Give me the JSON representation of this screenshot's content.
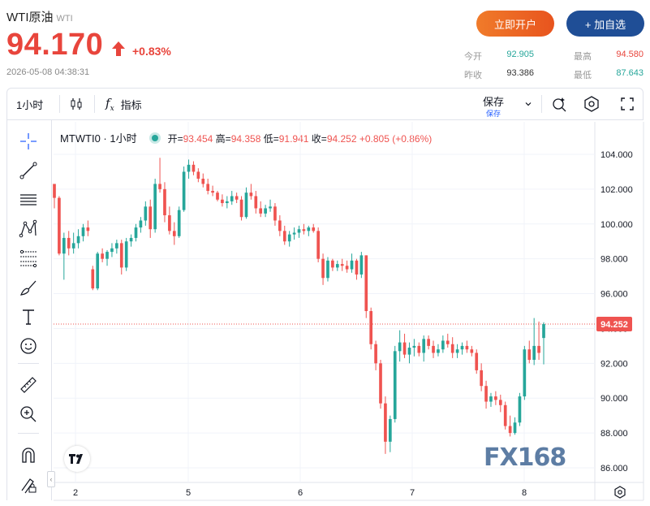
{
  "header": {
    "title": "WTI原油",
    "code": "WTI",
    "price": "94.170",
    "change_pct": "+0.83%",
    "timestamp": "2026-05-08 04:38:31",
    "open_button": "立即开户",
    "watch_button": "+ 加自选",
    "stats": {
      "open_label": "今开",
      "open_value": "92.905",
      "high_label": "最高",
      "high_value": "94.580",
      "prev_label": "昨收",
      "prev_value": "93.386",
      "low_label": "最低",
      "low_value": "87.643"
    },
    "up_color": "#e8453c"
  },
  "toolbar": {
    "interval": "1小时",
    "indicators": "指标",
    "save": "保存",
    "save_sub": "保存"
  },
  "legend": {
    "symbol": "MTWTI0 · 1小时",
    "open_label": "开=",
    "open_value": "93.454",
    "high_label": "高=",
    "high_value": "94.358",
    "low_label": "低=",
    "low_value": "91.941",
    "close_label": "收=",
    "close_value": "94.252",
    "change": "+0.805 (+0.86%)"
  },
  "watermark": "FX168",
  "chart_data": {
    "type": "candlestick",
    "title": "MTWTI0 · 1小时",
    "x_tick_labels": [
      "2",
      "5",
      "6",
      "7",
      "8"
    ],
    "ylim": [
      85,
      106
    ],
    "y_tick_labels": [
      "104.000",
      "102.000",
      "100.000",
      "98.000",
      "96.000",
      "94.000",
      "92.000",
      "90.000",
      "88.000",
      "86.000"
    ],
    "y_ticks": [
      104,
      102,
      100,
      98,
      96,
      94,
      92,
      90,
      88,
      86
    ],
    "last_price": 94.252,
    "last_price_label": "94.252",
    "up_color": "#26a69a",
    "down_color": "#ef5350",
    "candles": [
      [
        102.3,
        102.3,
        100.9,
        101.5
      ],
      [
        101.5,
        101.6,
        98.2,
        98.3
      ],
      [
        98.3,
        99.5,
        96.8,
        99.2
      ],
      [
        99.2,
        99.6,
        98.2,
        98.6
      ],
      [
        98.6,
        99.5,
        98.3,
        98.9
      ],
      [
        98.9,
        99.7,
        98.6,
        99.3
      ],
      [
        99.3,
        100.0,
        99.0,
        99.8
      ],
      [
        99.8,
        100.2,
        99.3,
        99.6
      ],
      [
        97.4,
        97.6,
        96.2,
        96.3
      ],
      [
        96.3,
        98.4,
        96.2,
        98.3
      ],
      [
        98.3,
        98.6,
        97.8,
        98.0
      ],
      [
        98.0,
        98.5,
        97.6,
        98.4
      ],
      [
        98.4,
        98.9,
        98.1,
        98.6
      ],
      [
        98.6,
        99.1,
        98.3,
        98.9
      ],
      [
        98.9,
        99.1,
        97.1,
        97.5
      ],
      [
        97.5,
        99.2,
        97.3,
        99.0
      ],
      [
        99.0,
        99.4,
        98.7,
        99.2
      ],
      [
        99.2,
        100.0,
        99.0,
        99.8
      ],
      [
        99.8,
        100.4,
        99.5,
        100.2
      ],
      [
        100.2,
        101.3,
        99.9,
        101.0
      ],
      [
        101.0,
        101.4,
        99.2,
        99.7
      ],
      [
        99.7,
        102.6,
        99.5,
        102.3
      ],
      [
        102.3,
        103.8,
        101.8,
        102.0
      ],
      [
        102.0,
        102.4,
        100.1,
        100.5
      ],
      [
        100.5,
        101.0,
        99.4,
        99.6
      ],
      [
        99.6,
        100.1,
        98.8,
        99.3
      ],
      [
        99.3,
        101.0,
        99.2,
        100.8
      ],
      [
        100.8,
        103.3,
        100.7,
        103.0
      ],
      [
        103.0,
        103.7,
        102.6,
        103.4
      ],
      [
        103.4,
        103.6,
        102.8,
        103.0
      ],
      [
        103.0,
        103.2,
        102.4,
        102.6
      ],
      [
        102.6,
        102.9,
        102.1,
        102.3
      ],
      [
        102.3,
        102.6,
        101.7,
        101.9
      ],
      [
        101.9,
        102.2,
        101.6,
        101.8
      ],
      [
        101.8,
        101.9,
        101.3,
        101.4
      ],
      [
        101.4,
        101.7,
        101.0,
        101.2
      ],
      [
        101.2,
        101.6,
        100.9,
        101.3
      ],
      [
        101.3,
        101.9,
        101.1,
        101.6
      ],
      [
        101.6,
        101.8,
        101.2,
        101.4
      ],
      [
        101.4,
        101.6,
        100.2,
        100.4
      ],
      [
        100.4,
        102.1,
        100.3,
        101.8
      ],
      [
        101.8,
        102.3,
        101.4,
        101.6
      ],
      [
        101.6,
        101.9,
        100.6,
        100.9
      ],
      [
        100.9,
        101.3,
        100.4,
        100.6
      ],
      [
        100.6,
        101.1,
        100.4,
        100.9
      ],
      [
        100.9,
        101.4,
        100.7,
        101.0
      ],
      [
        101.0,
        101.2,
        99.9,
        100.2
      ],
      [
        100.2,
        100.5,
        99.3,
        99.6
      ],
      [
        99.6,
        99.9,
        98.8,
        99.0
      ],
      [
        99.0,
        99.6,
        98.7,
        99.4
      ],
      [
        99.4,
        99.8,
        99.1,
        99.5
      ],
      [
        99.5,
        99.9,
        99.2,
        99.7
      ],
      [
        99.7,
        100.0,
        99.4,
        99.6
      ],
      [
        99.6,
        99.9,
        99.3,
        99.8
      ],
      [
        99.8,
        100.0,
        99.5,
        99.6
      ],
      [
        99.6,
        99.8,
        97.8,
        98.0
      ],
      [
        98.0,
        98.3,
        96.5,
        96.9
      ],
      [
        96.9,
        98.1,
        96.7,
        97.9
      ],
      [
        97.9,
        98.0,
        97.3,
        97.5
      ],
      [
        97.5,
        97.9,
        97.3,
        97.7
      ],
      [
        97.7,
        98.0,
        97.3,
        97.6
      ],
      [
        97.6,
        97.9,
        97.2,
        97.4
      ],
      [
        97.4,
        98.3,
        97.2,
        97.9
      ],
      [
        97.9,
        98.0,
        96.8,
        97.1
      ],
      [
        97.1,
        98.4,
        96.9,
        98.2
      ],
      [
        98.2,
        98.2,
        94.6,
        95.0
      ],
      [
        95.0,
        95.2,
        92.8,
        93.1
      ],
      [
        93.1,
        93.3,
        91.6,
        92.0
      ],
      [
        92.0,
        92.2,
        89.4,
        89.7
      ],
      [
        89.7,
        90.1,
        86.8,
        87.5
      ],
      [
        87.5,
        89.0,
        86.9,
        88.8
      ],
      [
        88.8,
        93.0,
        88.6,
        92.7
      ],
      [
        92.7,
        93.9,
        92.1,
        93.2
      ],
      [
        93.2,
        93.7,
        92.3,
        92.5
      ],
      [
        92.5,
        93.2,
        92.0,
        92.9
      ],
      [
        92.9,
        93.4,
        92.4,
        93.0
      ],
      [
        93.0,
        93.2,
        92.4,
        92.6
      ],
      [
        92.6,
        93.6,
        92.1,
        93.4
      ],
      [
        93.4,
        93.6,
        92.8,
        93.0
      ],
      [
        93.0,
        93.3,
        92.3,
        92.6
      ],
      [
        92.6,
        93.1,
        92.4,
        92.8
      ],
      [
        92.8,
        93.6,
        92.6,
        93.3
      ],
      [
        93.3,
        93.7,
        92.9,
        93.1
      ],
      [
        93.1,
        93.5,
        92.3,
        92.6
      ],
      [
        92.6,
        93.1,
        92.3,
        92.8
      ],
      [
        92.8,
        93.2,
        92.5,
        93.0
      ],
      [
        93.0,
        93.3,
        92.6,
        92.8
      ],
      [
        92.8,
        93.0,
        92.4,
        92.6
      ],
      [
        92.6,
        92.8,
        91.4,
        91.6
      ],
      [
        91.6,
        92.0,
        90.4,
        90.7
      ],
      [
        90.7,
        91.0,
        89.4,
        89.8
      ],
      [
        89.8,
        90.3,
        89.5,
        90.1
      ],
      [
        90.1,
        90.4,
        89.6,
        89.9
      ],
      [
        89.9,
        90.2,
        89.2,
        89.6
      ],
      [
        89.6,
        89.8,
        88.2,
        88.4
      ],
      [
        88.4,
        89.0,
        87.8,
        88.0
      ],
      [
        88.0,
        88.9,
        87.9,
        88.6
      ],
      [
        88.6,
        90.3,
        88.4,
        90.1
      ],
      [
        90.1,
        93.0,
        89.9,
        92.8
      ],
      [
        92.8,
        93.3,
        92.0,
        92.2
      ],
      [
        92.2,
        94.6,
        91.9,
        93.0
      ],
      [
        93.0,
        94.4,
        92.2,
        92.6
      ],
      [
        93.454,
        94.358,
        91.941,
        94.252
      ]
    ]
  }
}
